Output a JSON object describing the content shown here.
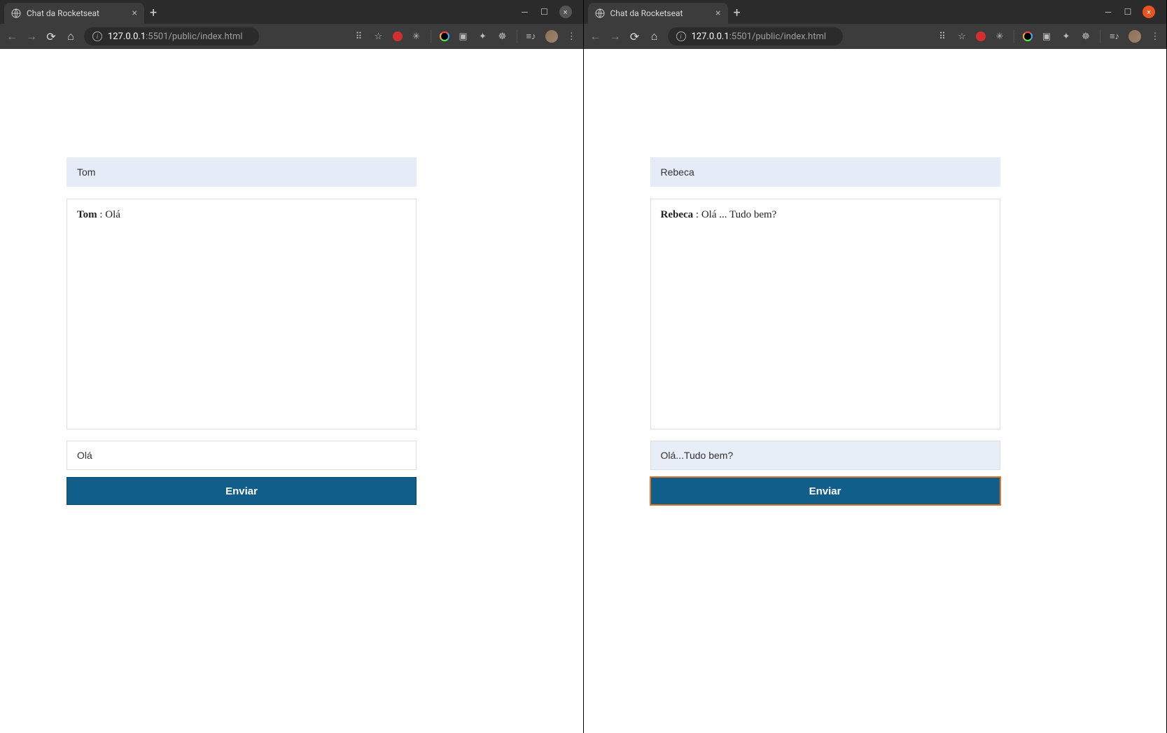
{
  "windows": [
    {
      "tab_title": "Chat da Rocketseat",
      "url_display_prefix": "127.0.0.1",
      "url_display_suffix": ":5501/public/index.html",
      "close_orange": false,
      "username": "Tom",
      "message": {
        "author": "Tom",
        "text": "Olá"
      },
      "input_value": "Olá",
      "input_active": false,
      "send_label": "Enviar",
      "send_focused": false
    },
    {
      "tab_title": "Chat da Rocketseat",
      "url_display_prefix": "127.0.0.1",
      "url_display_suffix": ":5501/public/index.html",
      "close_orange": true,
      "username": "Rebeca",
      "message": {
        "author": "Rebeca",
        "text": "Olá ... Tudo bem?"
      },
      "input_value": "Olá...Tudo bem?",
      "input_active": true,
      "send_label": "Enviar",
      "send_focused": true
    }
  ]
}
